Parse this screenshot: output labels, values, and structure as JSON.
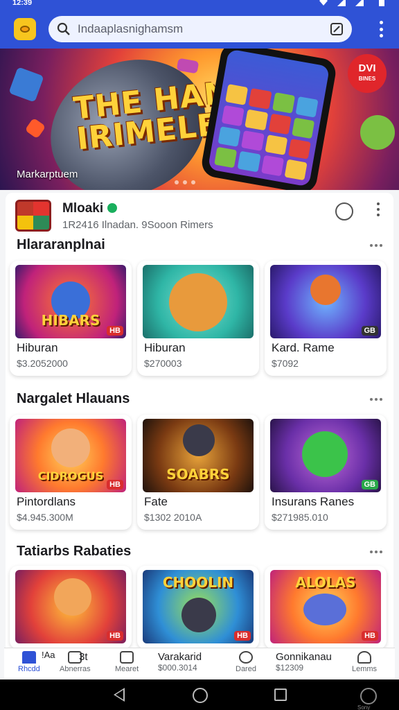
{
  "status_bar": {
    "time": "12:39"
  },
  "search": {
    "value": "Indaaplasnighamsm"
  },
  "banner": {
    "title_line1": "THE HANK",
    "title_line2": "IRIMELES",
    "badge_main": "DVI",
    "badge_sub": "BINES",
    "caption": "Markarptuem"
  },
  "developer": {
    "name": "Mloaki",
    "meta": "1R2416 Ilnadan. 9Sooon Rimers"
  },
  "sections": [
    {
      "title": "Hlararanplnai",
      "cards": [
        {
          "thumb_text": "HIBARS",
          "tag": "HB",
          "name": "Hiburan",
          "price": "$3.2052000"
        },
        {
          "thumb_text": "",
          "tag": "",
          "name": "Hiburan",
          "price": "$270003"
        },
        {
          "thumb_text": "",
          "tag": "GB",
          "name": "Kard. Rame",
          "price": "$7092"
        }
      ]
    },
    {
      "title": "Nargalet Hlauans",
      "cards": [
        {
          "thumb_text": "CIDROGUS",
          "tag": "HB",
          "name": "Pintordlans",
          "price": "$4.945.300M"
        },
        {
          "thumb_text": "SOABRS",
          "tag": "",
          "name": "Fate",
          "price": "$1302 2010A"
        },
        {
          "thumb_text": "",
          "tag": "GB",
          "name": "Insurans Ranes",
          "price": "$271985.010"
        }
      ]
    },
    {
      "title": "Tatiarbs Rabaties",
      "cards": [
        {
          "thumb_text": "",
          "tag": "HB",
          "name": "",
          "price": ""
        },
        {
          "thumb_text": "CHOOLIN",
          "tag": "HB",
          "name": "",
          "price": ""
        },
        {
          "thumb_text": "ALOLAS",
          "tag": "HB",
          "name": "",
          "price": ""
        }
      ]
    }
  ],
  "bottom_nav": {
    "home": "Rhcdd",
    "games": "Abnerras",
    "games_top": "!Aa",
    "games_top2": "3t",
    "news": "Mearet",
    "center_name": "Varakarid",
    "center_price": "$000.3014",
    "search": "Dared",
    "right_name": "Gonnikanau",
    "right_price": "$12309",
    "account": "Lemms"
  },
  "system": {
    "extra_label": "Sony"
  },
  "colors": {
    "accent": "#2f52d6",
    "background": "#f4f5f7"
  }
}
